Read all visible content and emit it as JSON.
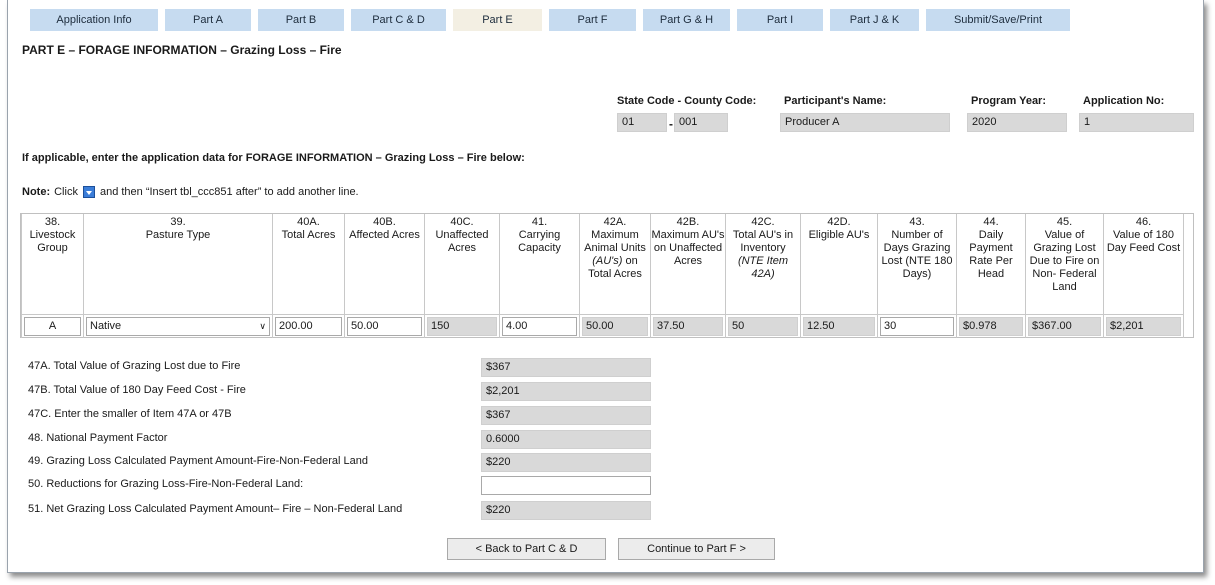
{
  "tabs": [
    {
      "label": "Application Info"
    },
    {
      "label": "Part A"
    },
    {
      "label": "Part B"
    },
    {
      "label": "Part C & D"
    },
    {
      "label": "Part E"
    },
    {
      "label": "Part F"
    },
    {
      "label": "Part G & H"
    },
    {
      "label": "Part I"
    },
    {
      "label": "Part J & K"
    },
    {
      "label": "Submit/Save/Print"
    }
  ],
  "active_tab": "Part E",
  "page_title": "PART E – FORAGE INFORMATION – Grazing Loss – Fire",
  "header": {
    "state_county_label": "State Code - County Code:",
    "state_code": "01",
    "dash": "-",
    "county_code": "001",
    "participant_label": "Participant's Name:",
    "participant_name": "Producer A",
    "program_year_label": "Program Year:",
    "program_year": "2020",
    "application_no_label": "Application No:",
    "application_no": "1"
  },
  "instructions": "If applicable, enter the application data for FORAGE INFORMATION – Grazing Loss – Fire below:",
  "note": {
    "label": "Note:",
    "text_before": "Click",
    "text_after": "and then “Insert tbl_ccc851 after” to add another line."
  },
  "columns": [
    {
      "num": "38.",
      "title": "Livestock Group"
    },
    {
      "num": "39.",
      "title": "Pasture Type"
    },
    {
      "num": "40A.",
      "title": "Total Acres"
    },
    {
      "num": "40B.",
      "title": "Affected Acres"
    },
    {
      "num": "40C.",
      "title": "Unaffected Acres"
    },
    {
      "num": "41.",
      "title": "Carrying Capacity"
    },
    {
      "num": "42A.",
      "title": "Maximum Animal Units",
      "title_italic": "(AU's)",
      "title_after": "on Total Acres"
    },
    {
      "num": "42B.",
      "title": "Maximum AU's on Unaffected Acres"
    },
    {
      "num": "42C.",
      "title": "Total AU's in Inventory",
      "title_italic": "(NTE Item 42A)"
    },
    {
      "num": "42D.",
      "title": "Eligible AU's"
    },
    {
      "num": "43.",
      "title": "Number of Days Grazing Lost (NTE 180 Days)"
    },
    {
      "num": "44.",
      "title": "Daily Payment Rate Per Head"
    },
    {
      "num": "45.",
      "title": "Value of Grazing Lost Due to Fire on Non- Federal Land"
    },
    {
      "num": "46.",
      "title": "Value of 180 Day Feed Cost"
    }
  ],
  "row": {
    "livestock_group": "A",
    "pasture_type": "Native",
    "total_acres": "200.00",
    "affected_acres": "50.00",
    "unaffected_acres": "150",
    "carrying_capacity": "4.00",
    "max_au_total": "50.00",
    "max_au_unaffected": "37.50",
    "total_au_inventory": "50",
    "eligible_au": "12.50",
    "days_grazing_lost": "30",
    "daily_rate": "$0.978",
    "value_grazing_lost": "$367.00",
    "feed_cost_180": "$2,201"
  },
  "summary": [
    {
      "label": "47A.  Total Value of Grazing Lost due to Fire",
      "value": "$367"
    },
    {
      "label": "47B.  Total Value of 180 Day Feed Cost  - Fire",
      "value": "$2,201"
    },
    {
      "label": "47C.  Enter the smaller of Item 47A or 47B",
      "value": "$367"
    },
    {
      "label": "48.   National Payment Factor",
      "value": "0.6000"
    },
    {
      "label": "49.   Grazing Loss Calculated Payment Amount-Fire-Non-Federal Land",
      "value": "$220"
    },
    {
      "label": "50.   Reductions for Grazing Loss-Fire-Non-Federal Land:",
      "value": ""
    },
    {
      "label": "51.   Net Grazing Loss Calculated Payment Amount– Fire – Non-Federal Land",
      "value": "$220"
    }
  ],
  "buttons": {
    "back": "< Back to Part C & D",
    "continue": "Continue to Part F >"
  }
}
